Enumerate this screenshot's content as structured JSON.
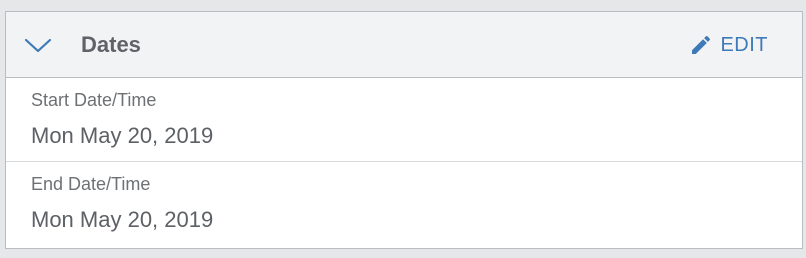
{
  "section": {
    "title": "Dates",
    "expanded": true,
    "edit_label": "EDIT",
    "accent_color": "#3e79b8"
  },
  "fields": [
    {
      "label": "Start Date/Time",
      "value": "Mon May 20, 2019"
    },
    {
      "label": "End Date/Time",
      "value": "Mon May 20, 2019"
    }
  ],
  "icons": {
    "collapse": "chevron-down-icon",
    "edit": "pencil-icon"
  }
}
